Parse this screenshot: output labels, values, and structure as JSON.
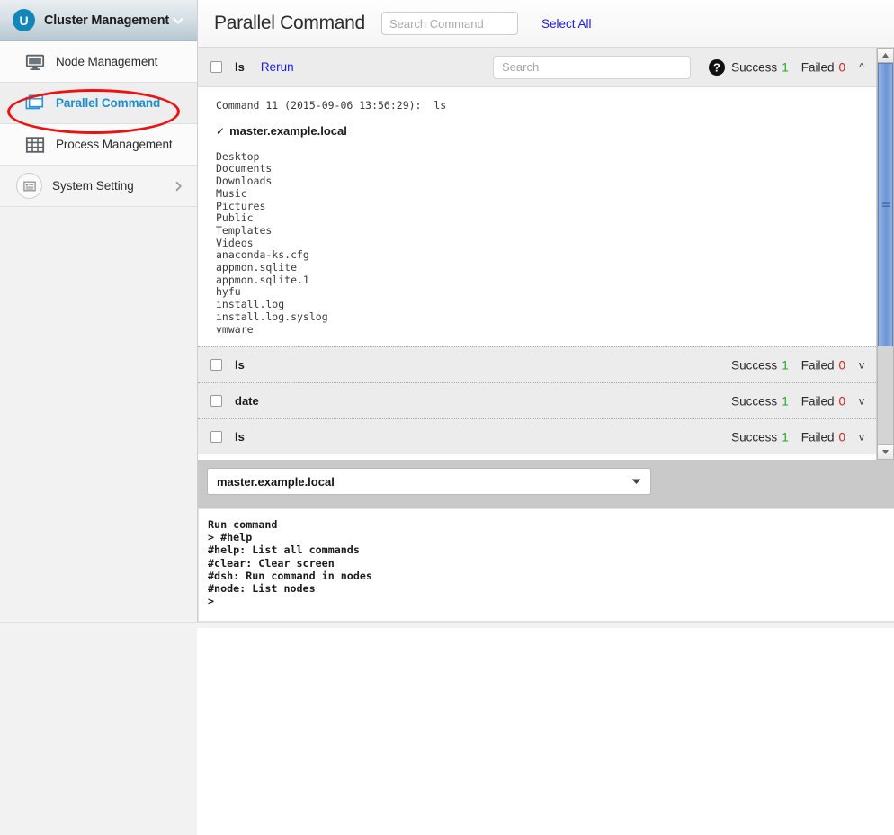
{
  "sidebar": {
    "brand": {
      "logo_glyph": "U",
      "title": "Cluster Management",
      "caret_icon": "chevron-down-icon"
    },
    "items": [
      {
        "label": "Node Management",
        "icon": "monitor-icon",
        "active": false
      },
      {
        "label": "Parallel Command",
        "icon": "windows-stack-icon",
        "active": true
      },
      {
        "label": "Process Management",
        "icon": "grid-icon",
        "active": false
      }
    ],
    "system_setting": {
      "label": "System Setting",
      "icon": "list-box-icon",
      "chevron": "chevron-right-icon"
    }
  },
  "header": {
    "title": "Parallel Command",
    "search_placeholder": "Search Command",
    "search_value": "",
    "select_all_label": "Select All"
  },
  "commands": [
    {
      "name": "ls",
      "rerun_label": "Rerun",
      "search_placeholder": "Search",
      "search_value": "",
      "help_icon": "help-circle-icon",
      "success_label": "Success",
      "success_count": "1",
      "failed_label": "Failed",
      "failed_count": "0",
      "toggle": "^",
      "expanded": true,
      "command_line": "Command 11 (2015-09-06 13:56:29):  ls",
      "host_check": "✓",
      "host": "master.example.local",
      "output": "Desktop\nDocuments\nDownloads\nMusic\nPictures\nPublic\nTemplates\nVideos\nanaconda-ks.cfg\nappmon.sqlite\nappmon.sqlite.1\nhyfu\ninstall.log\ninstall.log.syslog\nvmware"
    },
    {
      "name": "ls",
      "success_label": "Success",
      "success_count": "1",
      "failed_label": "Failed",
      "failed_count": "0",
      "toggle": "v",
      "expanded": false
    },
    {
      "name": "date",
      "success_label": "Success",
      "success_count": "1",
      "failed_label": "Failed",
      "failed_count": "0",
      "toggle": "v",
      "expanded": false
    },
    {
      "name": "ls",
      "success_label": "Success",
      "success_count": "1",
      "failed_label": "Failed",
      "failed_count": "0",
      "toggle": "v",
      "expanded": false
    }
  ],
  "node_select": {
    "selected": "master.example.local",
    "options": [
      "master.example.local"
    ],
    "caret_icon": "caret-down-icon"
  },
  "terminal": {
    "lines": [
      "Run command",
      "> #help",
      "#help: List all commands",
      "#clear: Clear screen",
      "#dsh: Run command in nodes",
      "#node: List nodes",
      ">"
    ]
  },
  "colors": {
    "accent_blue": "#1a8fd0",
    "link_blue": "#1a1aee",
    "success_green": "#1faa1f",
    "failed_red": "#e01b1b",
    "annotation_red": "#ee1111",
    "brand_circle": "#1386b8"
  }
}
